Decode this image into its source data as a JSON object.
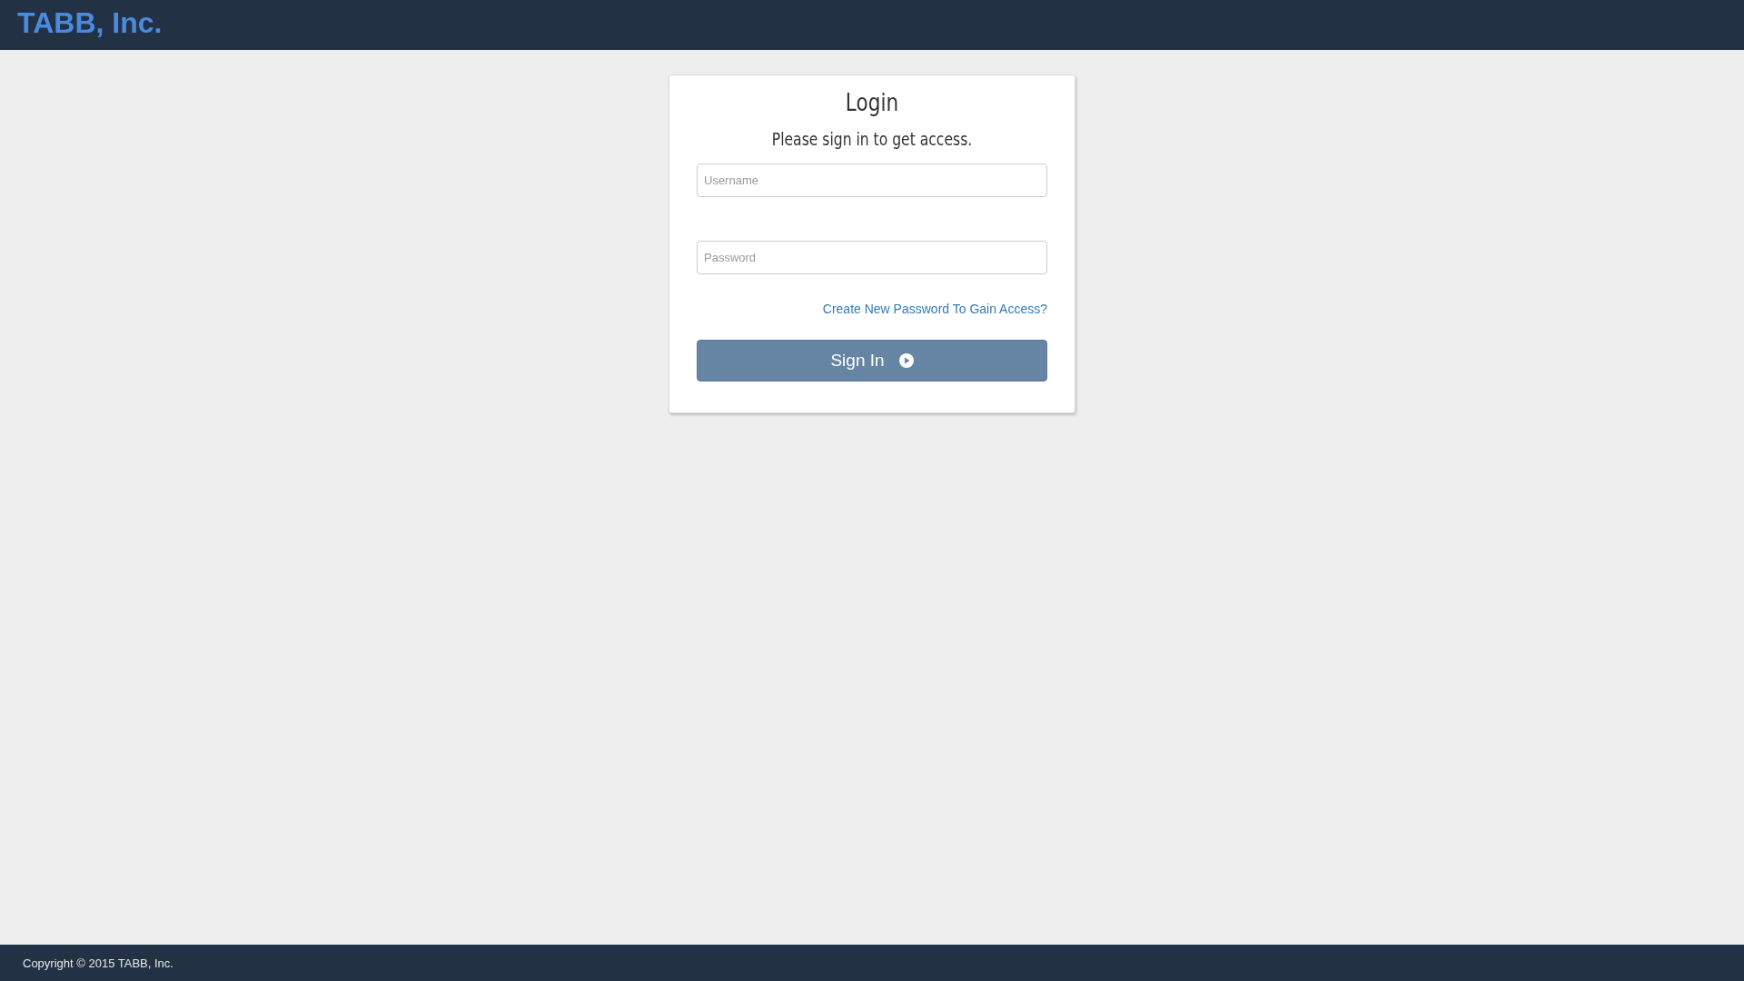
{
  "header": {
    "logo": "TABB, Inc."
  },
  "login": {
    "title": "Login",
    "subtitle": "Please sign in to get access.",
    "fields": [
      {
        "placeholder": "Username"
      },
      {
        "placeholder": "Password"
      }
    ],
    "link": "Create New Password To Gain Access?",
    "button": "Sign In"
  },
  "footer": {
    "copyright": "Copyright © 2015 TABB, Inc."
  }
}
